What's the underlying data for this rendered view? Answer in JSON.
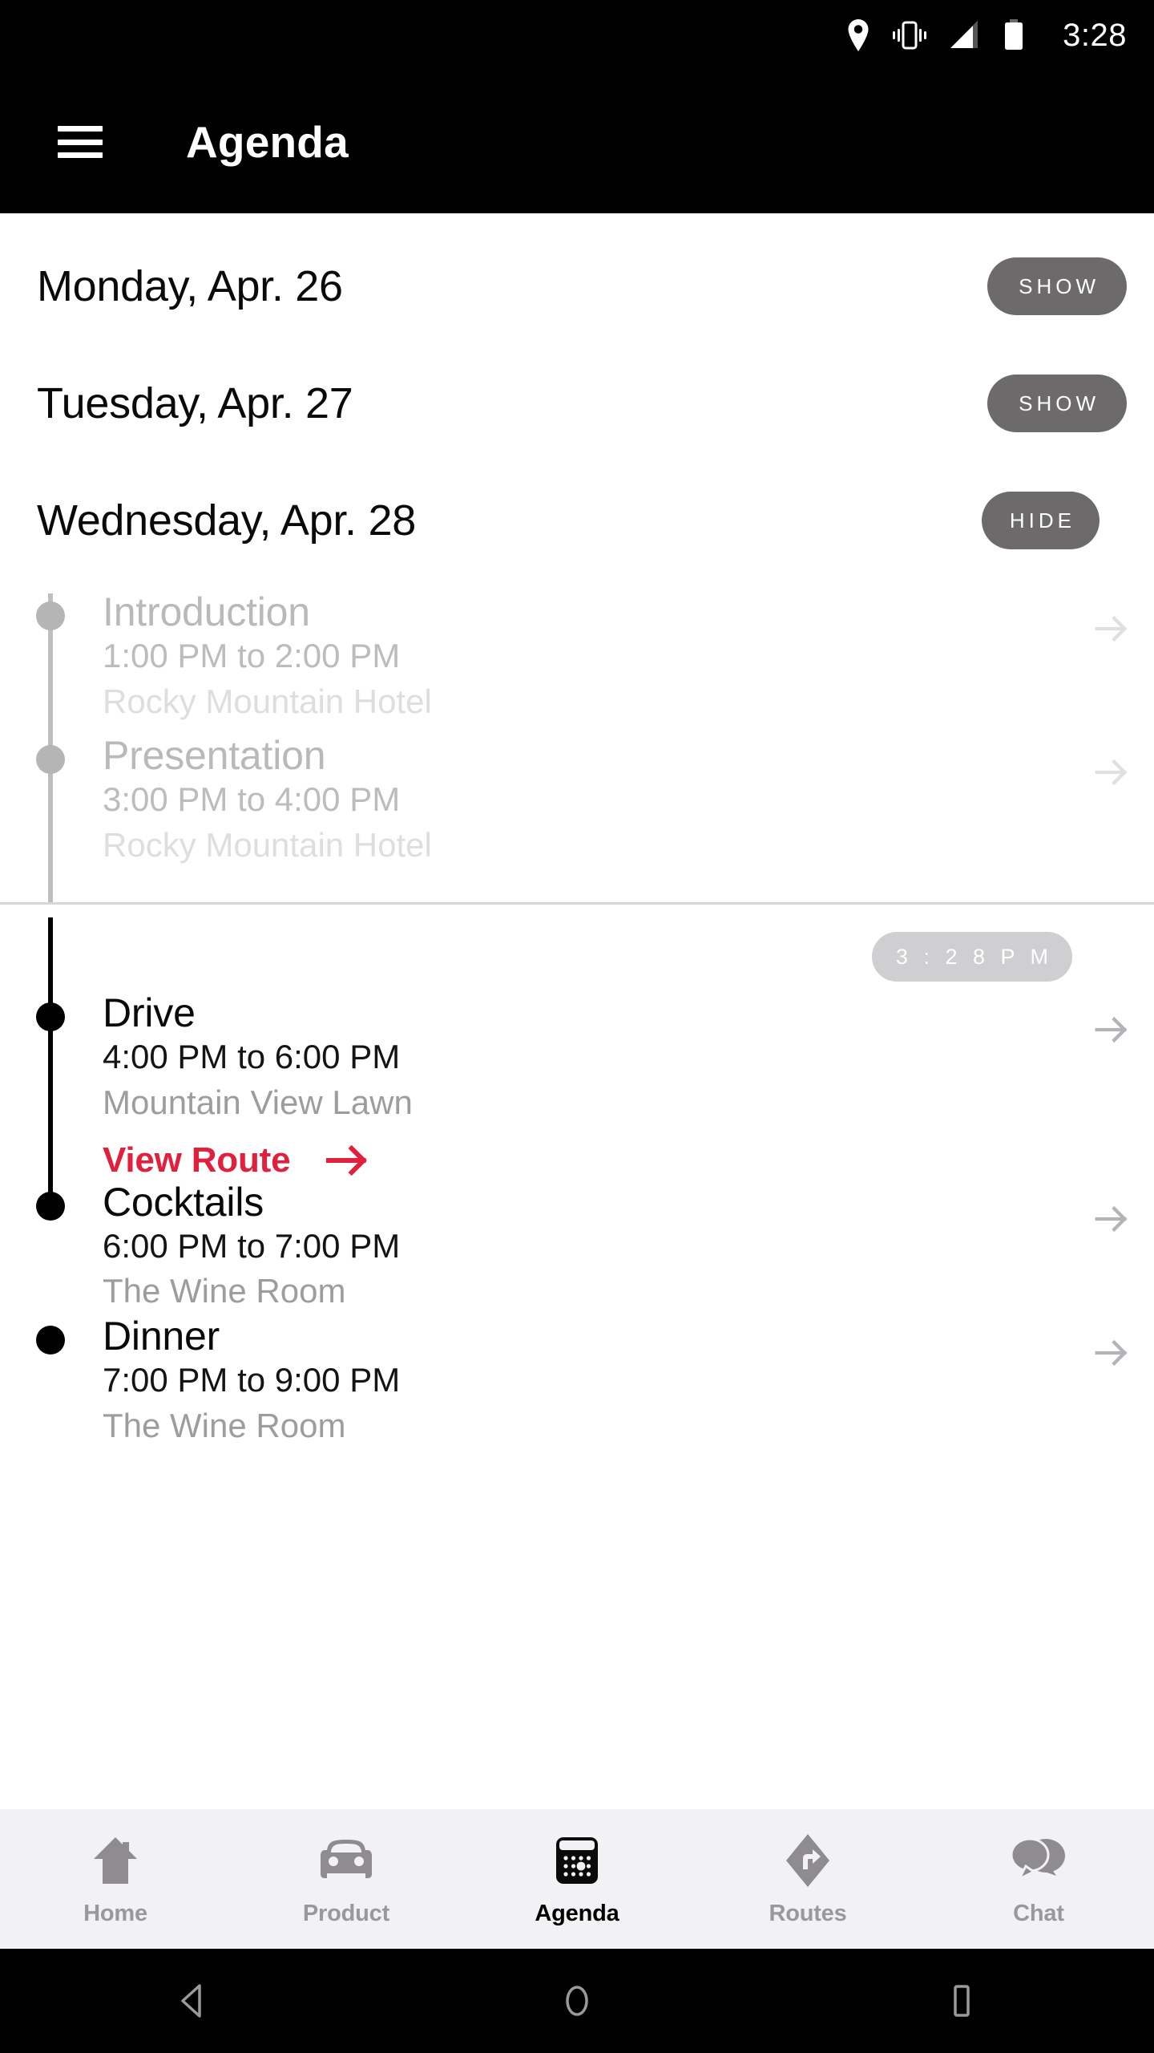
{
  "status_bar": {
    "time": "3:28",
    "icons": [
      "location-pin-icon",
      "vibrate-icon",
      "signal-icon",
      "battery-icon"
    ]
  },
  "app_bar": {
    "menu_icon": "hamburger-menu-icon",
    "title": "Agenda"
  },
  "days": [
    {
      "label": "Monday, Apr. 26",
      "toggle": "SHOW",
      "expanded": false
    },
    {
      "label": "Tuesday, Apr. 27",
      "toggle": "SHOW",
      "expanded": false
    },
    {
      "label": "Wednesday, Apr. 28",
      "toggle": "HIDE",
      "expanded": true
    }
  ],
  "now_marker": {
    "time": "3 : 2 8   P M"
  },
  "events": [
    {
      "title": "Introduction",
      "time": "1:00 PM to 2:00 PM",
      "place": "Rocky Mountain Hotel",
      "state": "past",
      "arrow": "arrow-right-icon"
    },
    {
      "title": "Presentation",
      "time": "3:00 PM to 4:00 PM",
      "place": "Rocky Mountain Hotel",
      "state": "past",
      "arrow": "arrow-right-icon"
    },
    {
      "title": "Drive",
      "time": "4:00 PM to 6:00 PM",
      "place": "Mountain View Lawn",
      "state": "active",
      "arrow": "arrow-right-icon",
      "action": {
        "label": "View Route",
        "icon": "arrow-right-icon",
        "color": "#e0203c"
      }
    },
    {
      "title": "Cocktails",
      "time": "6:00 PM to 7:00 PM",
      "place": "The Wine Room",
      "state": "active",
      "arrow": "arrow-right-icon"
    },
    {
      "title": "Dinner",
      "time": "7:00 PM to 9:00 PM",
      "place": "The Wine Room",
      "state": "active",
      "arrow": "arrow-right-icon"
    }
  ],
  "bottom_nav": {
    "items": [
      {
        "label": "Home",
        "icon": "home-icon",
        "active": false
      },
      {
        "label": "Product",
        "icon": "car-icon",
        "active": false
      },
      {
        "label": "Agenda",
        "icon": "calendar-icon",
        "active": true
      },
      {
        "label": "Routes",
        "icon": "navigation-icon",
        "active": false
      },
      {
        "label": "Chat",
        "icon": "chat-bubbles-icon",
        "active": false
      }
    ]
  },
  "android_nav": {
    "back": "back-triangle-icon",
    "home": "home-circle-icon",
    "recents": "recents-square-icon"
  },
  "colors": {
    "accent_red": "#e0203c",
    "toggle_gray": "#6d6a6c",
    "nav_bg": "#f2f1f3",
    "bar_black": "#000000"
  }
}
